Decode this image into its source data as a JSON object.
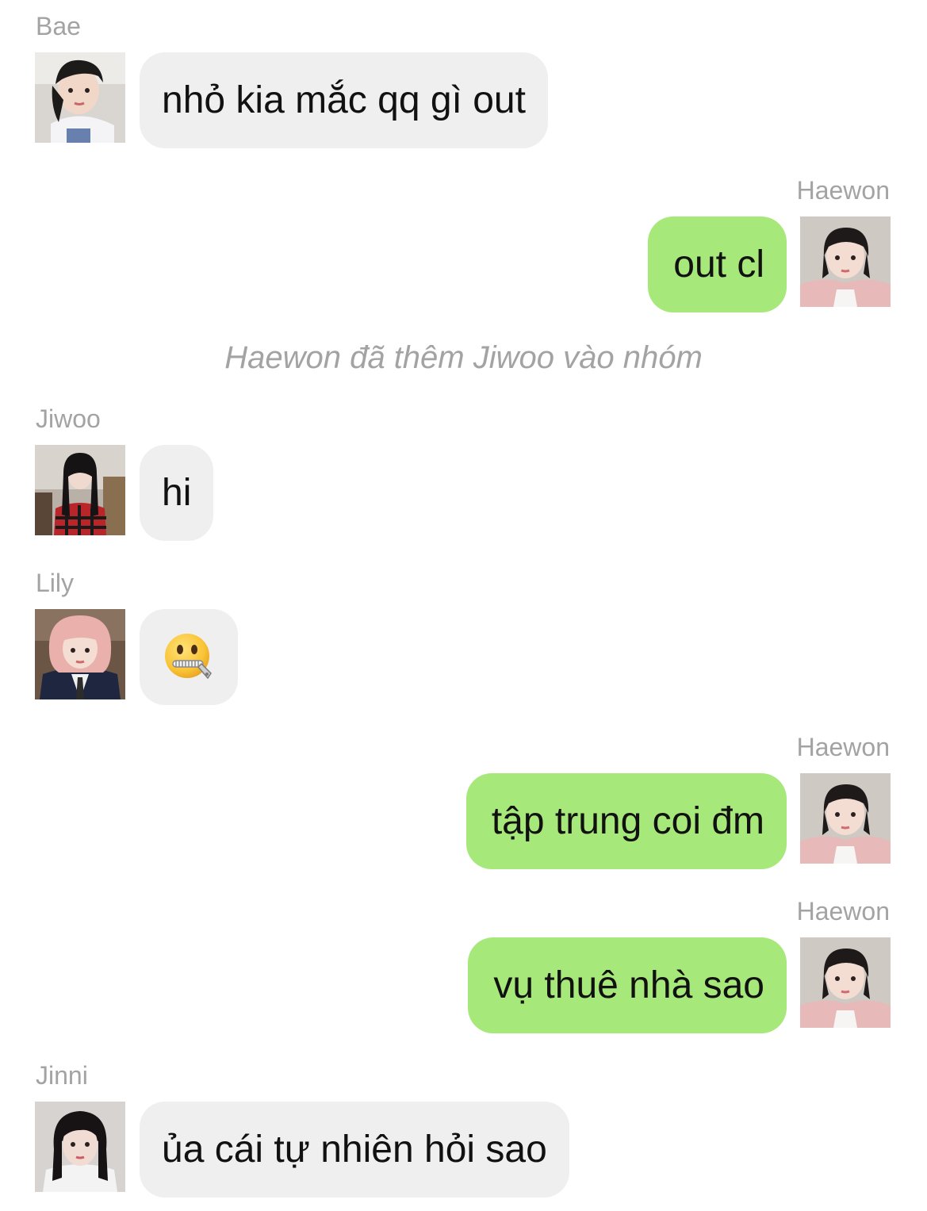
{
  "messages": [
    {
      "sender": "Bae",
      "text": "nhỏ kia mắc qq gì out",
      "side": "left"
    },
    {
      "sender": "Haewon",
      "text": "out cl",
      "side": "right"
    },
    {
      "system": "Haewon đã thêm Jiwoo vào nhóm"
    },
    {
      "sender": "Jiwoo",
      "text": "hi",
      "side": "left"
    },
    {
      "sender": "Lily",
      "emoji": "zipper-mouth-face",
      "side": "left"
    },
    {
      "sender": "Haewon",
      "text": "tập trung coi đm",
      "side": "right"
    },
    {
      "sender": "Haewon",
      "text": "vụ thuê nhà sao",
      "side": "right"
    },
    {
      "sender": "Jinni",
      "text": "ủa cái tự nhiên hỏi sao",
      "side": "left"
    }
  ],
  "colors": {
    "incoming_bubble": "#efefef",
    "outgoing_bubble": "#a7e87a",
    "name_text": "#a3a3a3",
    "message_text": "#111111"
  }
}
